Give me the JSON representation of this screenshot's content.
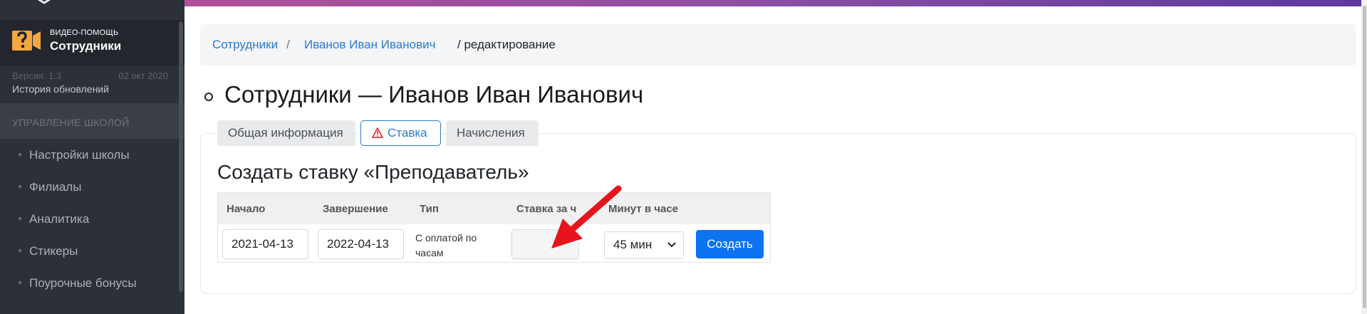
{
  "sidebar": {
    "help_caption": "ВИДЕО-ПОМОЩЬ",
    "help_title": "Сотрудники",
    "version": "Версия: 1.3",
    "version_date": "02 окт 2020",
    "history_link": "История обновлений",
    "section_label": "УПРАВЛЕНИЕ ШКОЛОЙ",
    "items": [
      {
        "label": "Настройки школы"
      },
      {
        "label": "Филиалы"
      },
      {
        "label": "Аналитика"
      },
      {
        "label": "Стикеры"
      },
      {
        "label": "Поурочные бонусы"
      }
    ]
  },
  "breadcrumb": {
    "item1": "Сотрудники",
    "sep": "/",
    "item2": "Иванов Иван Иванович",
    "current": "/ редактирование"
  },
  "page": {
    "title": "Сотрудники — Иванов Иван Иванович"
  },
  "tabs": [
    {
      "label": "Общая информация"
    },
    {
      "label": "Ставка"
    },
    {
      "label": "Начисления"
    }
  ],
  "form": {
    "title": "Создать ставку «Преподаватель»",
    "columns": {
      "start": "Начало",
      "end": "Завершение",
      "type": "Тип",
      "rate": "Ставка за ч",
      "minutes": "Минут в часе"
    },
    "row": {
      "start": "2021-04-13",
      "end": "2022-04-13",
      "type": "С оплатой по часам",
      "rate": "",
      "minutes": "45 мин"
    },
    "create_label": "Создать"
  },
  "colors": {
    "accent": "#0d73f0",
    "link": "#2a7ad0",
    "annotation_arrow": "#e8141b",
    "sidebar_bg": "#2c3038"
  }
}
